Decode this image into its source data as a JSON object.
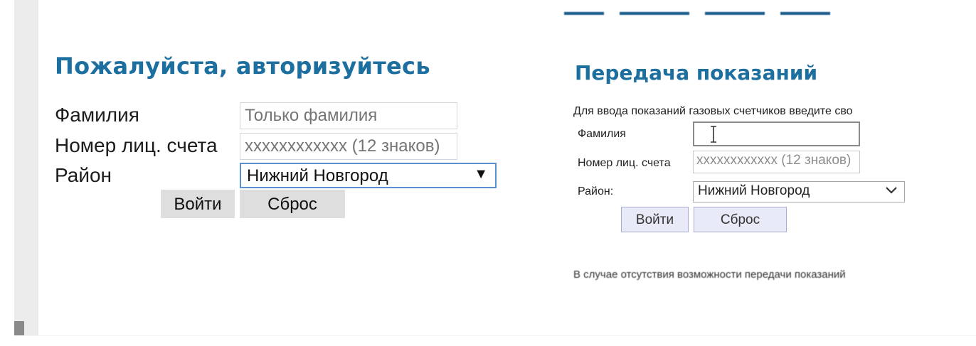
{
  "left": {
    "title": "Пожалуйста, авторизуйтесь",
    "fields": {
      "surname_label": "Фамилия",
      "surname_placeholder": "Только фамилия",
      "account_label": "Номер лиц. счета",
      "account_placeholder": "xxxxxxxxxxxx (12 знаков)",
      "district_label": "Район",
      "district_value": "Нижний Новгород"
    },
    "buttons": {
      "login": "Войти",
      "reset": "Сброс"
    }
  },
  "right": {
    "title": "Передача показаний",
    "description": "Для ввода показаний газовых счетчиков введите сво",
    "fields": {
      "surname_label": "Фамилия",
      "account_label": "Номер лиц. счета",
      "account_placeholder": "xxxxxxxxxxxx (12 знаков)",
      "district_label": "Район:",
      "district_value": "Нижний Новгород"
    },
    "buttons": {
      "login": "Войти",
      "reset": "Сброс"
    },
    "footer": "В случае отсутствия возможности передачи показаний"
  },
  "colors": {
    "title": "#1d6f9f",
    "select_focus_border": "#5a8fd0",
    "button_bg": "#dedede"
  },
  "icons": {
    "dropdown_left": "triangle-down-icon",
    "dropdown_right": "chevron-down-icon",
    "cursor": "text-cursor-icon"
  }
}
